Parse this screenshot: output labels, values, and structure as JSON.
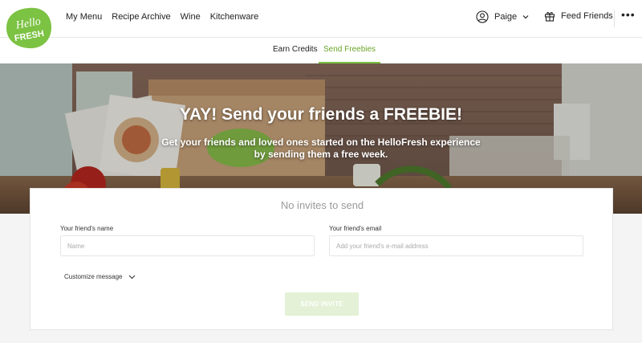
{
  "brand": {
    "logo_line1": "Hello",
    "logo_line2": "FRESH",
    "green": "#7cc243",
    "dark_green": "#6aa528"
  },
  "nav": {
    "links": [
      "My Menu",
      "Recipe Archive",
      "Wine",
      "Kitchenware"
    ]
  },
  "user": {
    "name": "Paige",
    "icon": "user-circle-icon"
  },
  "feed_friends": {
    "label": "Feed Friends",
    "icon": "gift-icon"
  },
  "more": {
    "label": "•••"
  },
  "tabs": [
    {
      "label": "Earn Credits",
      "active": false
    },
    {
      "label": "Send Freebies",
      "active": true
    }
  ],
  "hero": {
    "title": "YAY! Send your friends a FREEBIE!",
    "subtitle": "Get your friends and loved ones started on the HelloFresh experience by sending them a free week."
  },
  "invite_form": {
    "status": "No invites to send",
    "name_label": "Your friend's name",
    "name_placeholder": "Name",
    "email_label": "Your friend's email",
    "email_placeholder": "Add your friend's e-mail address",
    "customize_label": "Customize message",
    "send_label": "SEND INVITE"
  }
}
